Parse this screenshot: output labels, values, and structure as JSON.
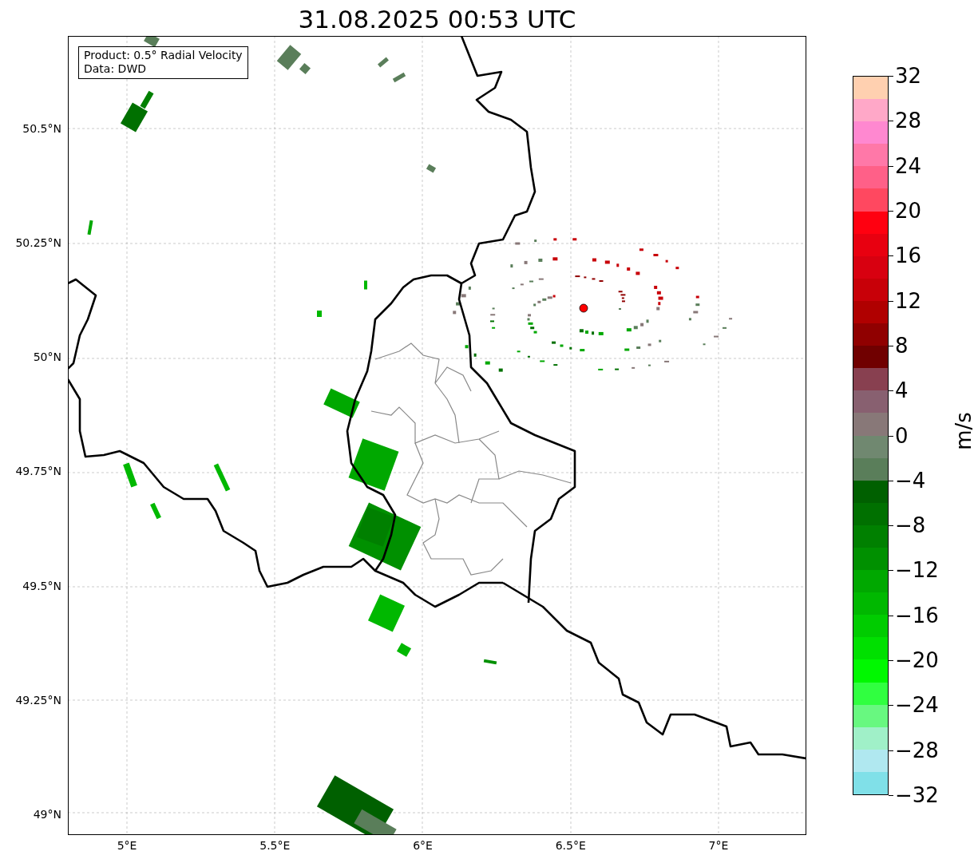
{
  "title": "31.08.2025 00:53 UTC",
  "info_box": {
    "lines": [
      "Product: 0.5° Radial Velocity",
      "Data: DWD"
    ]
  },
  "x_axis": {
    "ticks": [
      "5°E",
      "5.5°E",
      "6°E",
      "6.5°E",
      "7°E"
    ]
  },
  "y_axis": {
    "ticks": [
      "50.5°N",
      "50.25°N",
      "50°N",
      "49.75°N",
      "49.5°N",
      "49.25°N",
      "49°N"
    ]
  },
  "colorbar": {
    "label": "m/s",
    "ticks": [
      "32",
      "28",
      "24",
      "20",
      "16",
      "12",
      "8",
      "4",
      "0",
      "−4",
      "−8",
      "−12",
      "−16",
      "−20",
      "−24",
      "−28",
      "−32"
    ],
    "segments": [
      {
        "color": "#ffd0b0"
      },
      {
        "color": "#ffa8c8"
      },
      {
        "color": "#ff88d0"
      },
      {
        "color": "#ff78a8"
      },
      {
        "color": "#ff6088"
      },
      {
        "color": "#ff4860"
      },
      {
        "color": "#ff0010"
      },
      {
        "color": "#e80010"
      },
      {
        "color": "#d80010"
      },
      {
        "color": "#c80008"
      },
      {
        "color": "#b00000"
      },
      {
        "color": "#900000"
      },
      {
        "color": "#700000"
      },
      {
        "color": "#884050"
      },
      {
        "color": "#886070"
      },
      {
        "color": "#887878"
      },
      {
        "color": "#708870"
      },
      {
        "color": "#5a7e5a"
      },
      {
        "color": "#006000"
      },
      {
        "color": "#007000"
      },
      {
        "color": "#008000"
      },
      {
        "color": "#009000"
      },
      {
        "color": "#00a800"
      },
      {
        "color": "#00b800"
      },
      {
        "color": "#00cc00"
      },
      {
        "color": "#00e000"
      },
      {
        "color": "#00f800"
      },
      {
        "color": "#30ff40"
      },
      {
        "color": "#68f880"
      },
      {
        "color": "#a0f0c8"
      },
      {
        "color": "#b0e8f0"
      },
      {
        "color": "#80e0e8"
      }
    ]
  }
}
